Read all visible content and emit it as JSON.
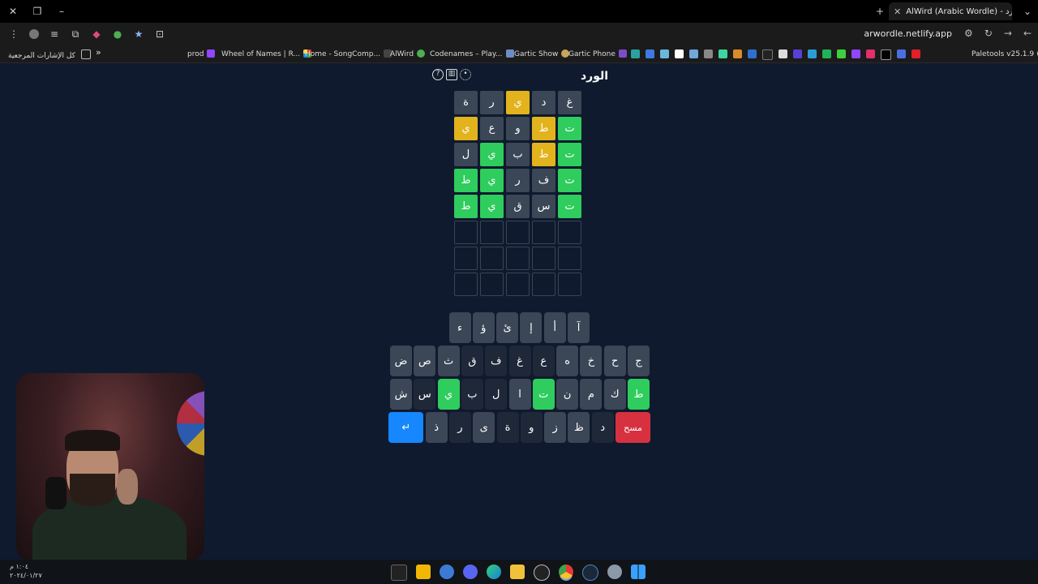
{
  "browser": {
    "tab_title": "AlWird (Arabic Wordle) - الورد",
    "url": "arwordle.netlify.app",
    "bookmarks": {
      "all_bookmarks": "كل الإشارات المرجعية",
      "expand": "»",
      "items": [
        "prod",
        "Wheel of Names | R...",
        "Home - SongComp...",
        "AlWird",
        "Codenames – Play...",
        "Gartic Show",
        "Gartic Phone",
        "Paletools v25.1.9"
      ]
    }
  },
  "game": {
    "title": "الورد",
    "icons": [
      "help-icon",
      "stats-icon",
      "settings-icon"
    ],
    "board": [
      [
        {
          "l": "غ",
          "s": "absent"
        },
        {
          "l": "د",
          "s": "absent"
        },
        {
          "l": "ي",
          "s": "present"
        },
        {
          "l": "ر",
          "s": "absent"
        },
        {
          "l": "ة",
          "s": "absent"
        }
      ],
      [
        {
          "l": "ت",
          "s": "correct"
        },
        {
          "l": "ط",
          "s": "present"
        },
        {
          "l": "و",
          "s": "absent"
        },
        {
          "l": "ع",
          "s": "absent"
        },
        {
          "l": "ي",
          "s": "present"
        }
      ],
      [
        {
          "l": "ت",
          "s": "correct"
        },
        {
          "l": "ط",
          "s": "present"
        },
        {
          "l": "ب",
          "s": "absent"
        },
        {
          "l": "ي",
          "s": "correct"
        },
        {
          "l": "ل",
          "s": "absent"
        }
      ],
      [
        {
          "l": "ت",
          "s": "correct"
        },
        {
          "l": "ف",
          "s": "absent"
        },
        {
          "l": "ر",
          "s": "absent"
        },
        {
          "l": "ي",
          "s": "correct"
        },
        {
          "l": "ط",
          "s": "correct"
        }
      ],
      [
        {
          "l": "ت",
          "s": "correct"
        },
        {
          "l": "س",
          "s": "absent"
        },
        {
          "l": "ق",
          "s": "absent"
        },
        {
          "l": "ي",
          "s": "correct"
        },
        {
          "l": "ط",
          "s": "correct"
        }
      ],
      [
        {
          "l": "",
          "s": "empty"
        },
        {
          "l": "",
          "s": "empty"
        },
        {
          "l": "",
          "s": "empty"
        },
        {
          "l": "",
          "s": "empty"
        },
        {
          "l": "",
          "s": "empty"
        }
      ],
      [
        {
          "l": "",
          "s": "empty"
        },
        {
          "l": "",
          "s": "empty"
        },
        {
          "l": "",
          "s": "empty"
        },
        {
          "l": "",
          "s": "empty"
        },
        {
          "l": "",
          "s": "empty"
        }
      ],
      [
        {
          "l": "",
          "s": "empty"
        },
        {
          "l": "",
          "s": "empty"
        },
        {
          "l": "",
          "s": "empty"
        },
        {
          "l": "",
          "s": "empty"
        },
        {
          "l": "",
          "s": "empty"
        }
      ]
    ],
    "keyboard": [
      [
        {
          "k": "آ",
          "s": "unused"
        },
        {
          "k": "أ",
          "s": "unused"
        },
        {
          "k": "إ",
          "s": "unused"
        },
        {
          "k": "ئ",
          "s": "unused"
        },
        {
          "k": "ؤ",
          "s": "unused"
        },
        {
          "k": "ء",
          "s": "unused"
        }
      ],
      [
        {
          "k": "ج",
          "s": "unused"
        },
        {
          "k": "ح",
          "s": "unused"
        },
        {
          "k": "خ",
          "s": "unused"
        },
        {
          "k": "ه",
          "s": "unused"
        },
        {
          "k": "ع",
          "s": "absent"
        },
        {
          "k": "غ",
          "s": "absent"
        },
        {
          "k": "ف",
          "s": "absent"
        },
        {
          "k": "ق",
          "s": "absent"
        },
        {
          "k": "ث",
          "s": "unused"
        },
        {
          "k": "ص",
          "s": "unused"
        },
        {
          "k": "ض",
          "s": "unused"
        }
      ],
      [
        {
          "k": "ط",
          "s": "correct"
        },
        {
          "k": "ك",
          "s": "unused"
        },
        {
          "k": "م",
          "s": "unused"
        },
        {
          "k": "ن",
          "s": "unused"
        },
        {
          "k": "ت",
          "s": "correct"
        },
        {
          "k": "ا",
          "s": "unused"
        },
        {
          "k": "ل",
          "s": "absent"
        },
        {
          "k": "ب",
          "s": "absent"
        },
        {
          "k": "ي",
          "s": "correct"
        },
        {
          "k": "س",
          "s": "absent"
        },
        {
          "k": "ش",
          "s": "unused"
        }
      ],
      [
        {
          "k": "مسح",
          "s": "delete"
        },
        {
          "k": "د",
          "s": "absent"
        },
        {
          "k": "ظ",
          "s": "unused"
        },
        {
          "k": "ز",
          "s": "unused"
        },
        {
          "k": "و",
          "s": "absent"
        },
        {
          "k": "ة",
          "s": "absent"
        },
        {
          "k": "ى",
          "s": "unused"
        },
        {
          "k": "ر",
          "s": "absent"
        },
        {
          "k": "ذ",
          "s": "unused"
        },
        {
          "k": "↵",
          "s": "enter"
        }
      ]
    ]
  },
  "taskbar": {
    "time": "١:٠٤ م",
    "date": "٢٠٢٤/٠١/٢٧"
  },
  "colors": {
    "background": "#0f1a2e",
    "absent": "#3b4656",
    "present": "#e2b31c",
    "correct": "#2fcc5e",
    "enter": "#1687ff",
    "delete": "#d7313f"
  }
}
